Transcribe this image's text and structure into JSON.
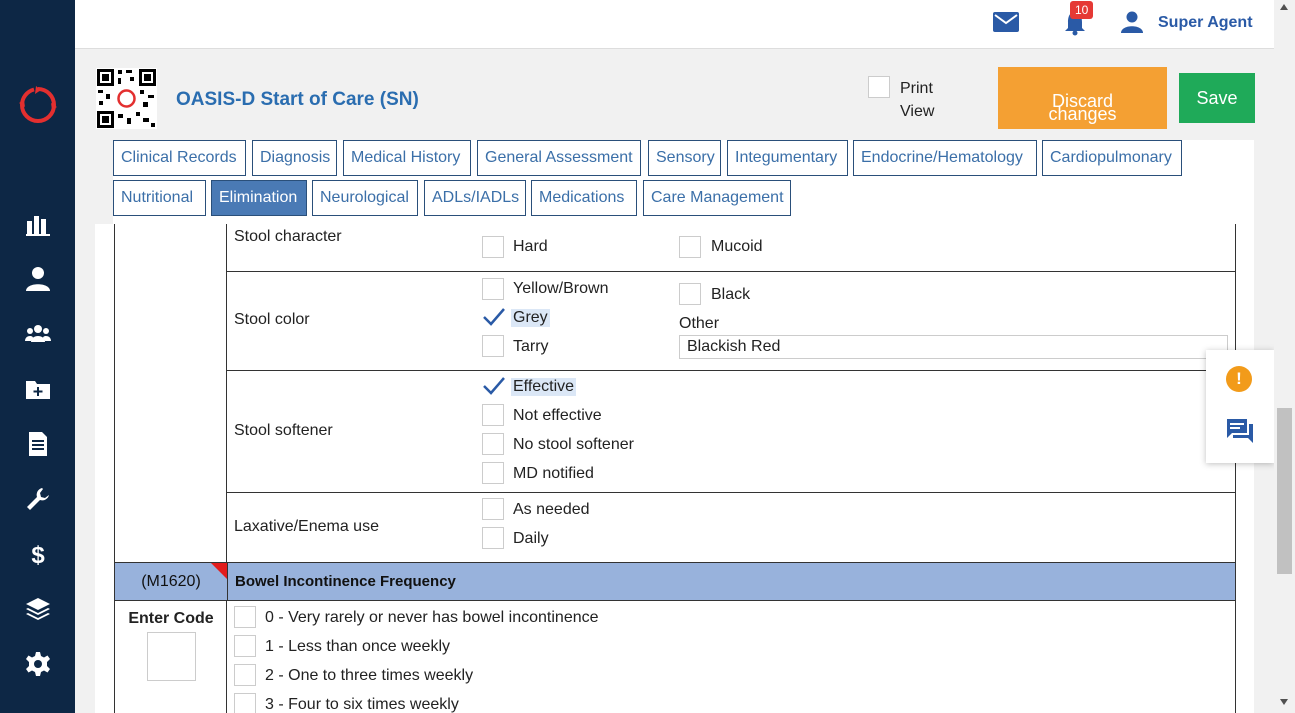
{
  "topbar": {
    "notification_count": "10",
    "user_name": "Super Agent",
    "icons": [
      "mail-icon",
      "bell-icon",
      "user-icon"
    ]
  },
  "header": {
    "title": "OASIS-D Start of Care (SN)",
    "print_line1": "Print",
    "print_line2": "View",
    "discard_line1": "Discard",
    "discard_line2": "changes",
    "save_label": "Save"
  },
  "sidebar": {
    "icons": [
      "dashboard-chart-icon",
      "patient-icon",
      "team-icon",
      "add-folder-icon",
      "document-icon",
      "wrench-icon",
      "billing-dollar-icon",
      "layers-icon",
      "settings-gear-icon"
    ]
  },
  "tabs": {
    "row1": [
      "Clinical Records",
      "Diagnosis",
      "Medical History",
      "General Assessment",
      "Sensory",
      "Integumentary",
      "Endocrine/Hematology",
      "Cardiopulmonary"
    ],
    "row2": [
      "Nutritional",
      "Elimination",
      "Neurological",
      "ADLs/IADLs",
      "Medications",
      "Care Management"
    ],
    "active": "Elimination"
  },
  "stool_character": {
    "label": "Stool character",
    "options": [
      {
        "label": "Hard",
        "checked": false
      },
      {
        "label": "Mucoid",
        "checked": false
      }
    ]
  },
  "stool_color": {
    "label": "Stool color",
    "options": [
      {
        "label": "Yellow/Brown",
        "checked": false
      },
      {
        "label": "Grey",
        "checked": true
      },
      {
        "label": "Tarry",
        "checked": false
      },
      {
        "label": "Black",
        "checked": false
      }
    ],
    "other_label": "Other",
    "other_value": "Blackish Red"
  },
  "stool_softener": {
    "label": "Stool softener",
    "options": [
      {
        "label": "Effective",
        "checked": true
      },
      {
        "label": "Not effective",
        "checked": false
      },
      {
        "label": "No stool softener",
        "checked": false
      },
      {
        "label": "MD notified",
        "checked": false
      }
    ]
  },
  "laxative": {
    "label": "Laxative/Enema use",
    "options": [
      {
        "label": "As needed",
        "checked": false
      },
      {
        "label": "Daily",
        "checked": false
      }
    ]
  },
  "m1620": {
    "code": "(M1620)",
    "title": "Bowel Incontinence Frequency",
    "enter_code": "Enter Code",
    "options": [
      "0 - Very rarely or never has bowel incontinence",
      "1 - Less than once weekly",
      "2 - One to three times weekly",
      "3 - Four to six times weekly"
    ]
  },
  "colors": {
    "sidebar": "#0d2745",
    "accent_blue": "#2a6db0",
    "discard": "#f4a033",
    "save": "#1faa59",
    "section_header": "#98b2dc"
  }
}
